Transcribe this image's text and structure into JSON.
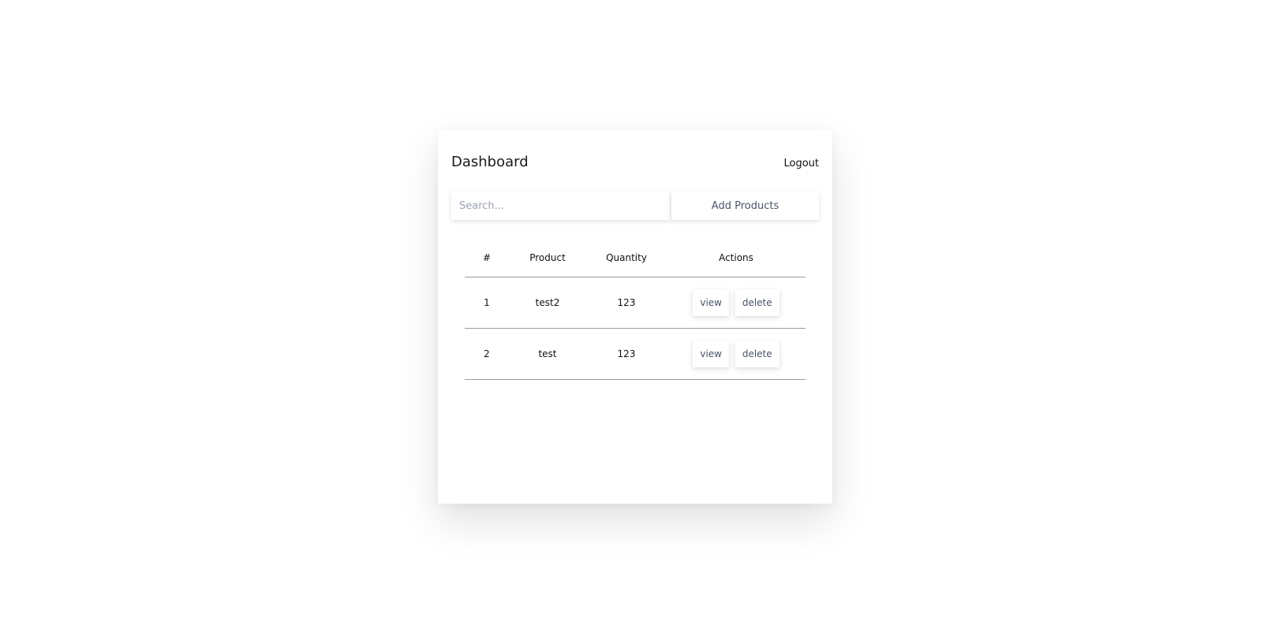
{
  "header": {
    "title": "Dashboard",
    "logout_label": "Logout"
  },
  "toolbar": {
    "search_placeholder": "Search...",
    "search_value": "",
    "add_label": "Add Products"
  },
  "table": {
    "columns": [
      "#",
      "Product",
      "Quantity",
      "Actions"
    ],
    "rows": [
      {
        "index": "1",
        "product": "test2",
        "quantity": "123",
        "view_label": "view",
        "delete_label": "delete"
      },
      {
        "index": "2",
        "product": "test",
        "quantity": "123",
        "view_label": "view",
        "delete_label": "delete"
      }
    ]
  }
}
